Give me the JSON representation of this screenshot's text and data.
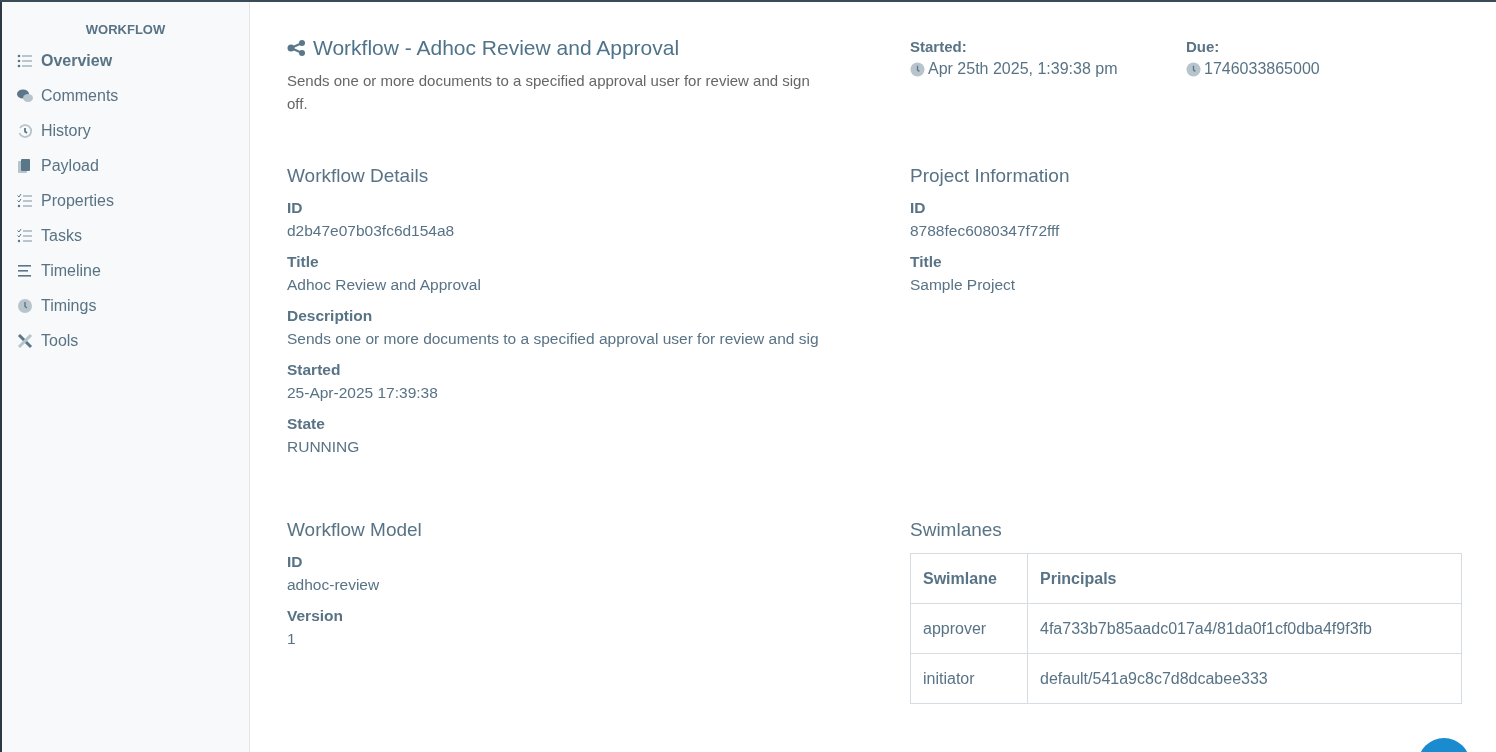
{
  "sidebar": {
    "heading": "WORKFLOW",
    "items": [
      {
        "label": "Overview",
        "selected": true
      },
      {
        "label": "Comments",
        "selected": false
      },
      {
        "label": "History",
        "selected": false
      },
      {
        "label": "Payload",
        "selected": false
      },
      {
        "label": "Properties",
        "selected": false
      },
      {
        "label": "Tasks",
        "selected": false
      },
      {
        "label": "Timeline",
        "selected": false
      },
      {
        "label": "Timings",
        "selected": false
      },
      {
        "label": "Tools",
        "selected": false
      }
    ]
  },
  "header": {
    "title": "Workflow - Adhoc Review and Approval",
    "description": "Sends one or more documents to a specified approval user for review and sign off.",
    "started": {
      "label": "Started:",
      "value": "Apr 25th 2025, 1:39:38 pm"
    },
    "due": {
      "label": "Due:",
      "value": "1746033865000"
    }
  },
  "workflow_details": {
    "heading": "Workflow Details",
    "fields": [
      {
        "label": "ID",
        "value": "d2b47e07b03fc6d154a8"
      },
      {
        "label": "Title",
        "value": "Adhoc Review and Approval"
      },
      {
        "label": "Description",
        "value": "Sends one or more documents to a specified approval user for review and sig"
      },
      {
        "label": "Started",
        "value": "25-Apr-2025 17:39:38"
      },
      {
        "label": "State",
        "value": "RUNNING"
      }
    ]
  },
  "project_information": {
    "heading": "Project Information",
    "fields": [
      {
        "label": "ID",
        "value": "8788fec6080347f72fff"
      },
      {
        "label": "Title",
        "value": "Sample Project"
      }
    ]
  },
  "workflow_model": {
    "heading": "Workflow Model",
    "fields": [
      {
        "label": "ID",
        "value": "adhoc-review"
      },
      {
        "label": "Version",
        "value": "1"
      }
    ]
  },
  "swimlanes": {
    "heading": "Swimlanes",
    "columns": [
      "Swimlane",
      "Principals"
    ],
    "rows": [
      [
        "approver",
        "4fa733b7b85aadc017a4/81da0f1cf0dba4f9f3fb"
      ],
      [
        "initiator",
        "default/541a9c8c7d8dcabee333"
      ]
    ]
  }
}
